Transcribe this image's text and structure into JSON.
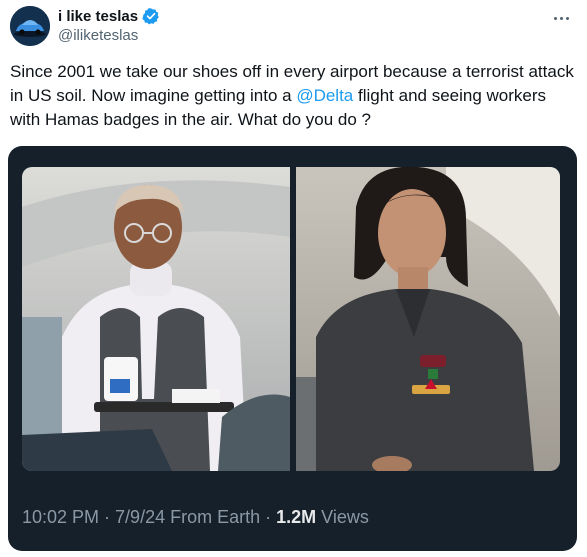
{
  "author": {
    "display_name": "i like teslas",
    "handle": "@iliketeslas",
    "verified": true,
    "avatar_icon": "car-avatar-icon"
  },
  "tweet": {
    "text_before_mention": "Since 2001 we take our shoes off in every airport because a terrorist attack in US soil. Now imagine getting into a ",
    "mention": "@Delta",
    "text_after_mention": " flight and seeing workers with Hamas badges in the air. What do you do ?"
  },
  "media": {
    "photos": [
      {
        "subject": "male flight attendant with serving cart"
      },
      {
        "subject": "female flight attendant in uniform"
      }
    ]
  },
  "meta": {
    "time": "10:02 PM",
    "separator": "·",
    "date": "7/9/24",
    "source": "From Earth",
    "views_count": "1.2M",
    "views_label": "Views"
  },
  "colors": {
    "accent": "#1d9bf0",
    "text": "#0f1419",
    "secondary": "#536471",
    "card_bg": "#15202b"
  }
}
